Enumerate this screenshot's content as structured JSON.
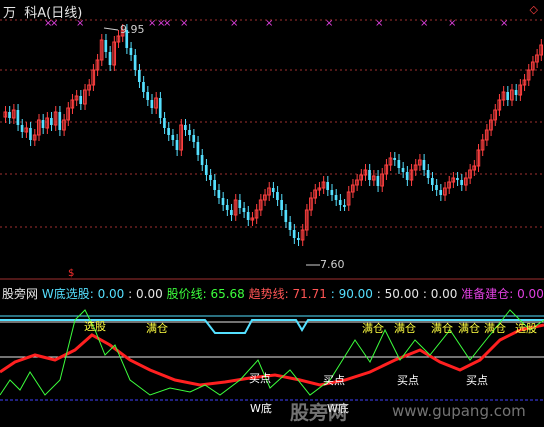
{
  "header": {
    "title": "万  科A(日线)",
    "diamond_icon": "diamond-outline-icon"
  },
  "price_chart": {
    "high_label": "9.95",
    "low_label": "7.60",
    "cross_marker_color": "#e040e0"
  },
  "indicator_bar": {
    "name": "股旁网",
    "w_bottom_label": "W底选股:",
    "w_bottom_value": "0.00",
    "sep1": ":",
    "sep1_value": "0.00",
    "stock_price_label": "股价线:",
    "stock_price_value": "65.68",
    "trend_label": "趋势线:",
    "trend_value": "71.71",
    "trend_sep": ":",
    "trend_sep_value": "90.00",
    "sep2": ":",
    "sep2_value": "50.00",
    "sep3": ":",
    "sep3_value": "0.00",
    "prepare_label": "准备建仓:",
    "prepare_value": "0.00"
  },
  "signals": {
    "choose": "选股",
    "full": "满仓",
    "buy": "买点",
    "wbottom": "W底"
  },
  "watermark": {
    "cn": "股旁网",
    "url": "www.gupang.com"
  },
  "colors": {
    "up": "#ff4040",
    "down": "#55e0ff",
    "trend": "#ff2020",
    "price_line": "#3cff3c",
    "level": "#55e0ff",
    "accent": "#e040e0"
  }
}
